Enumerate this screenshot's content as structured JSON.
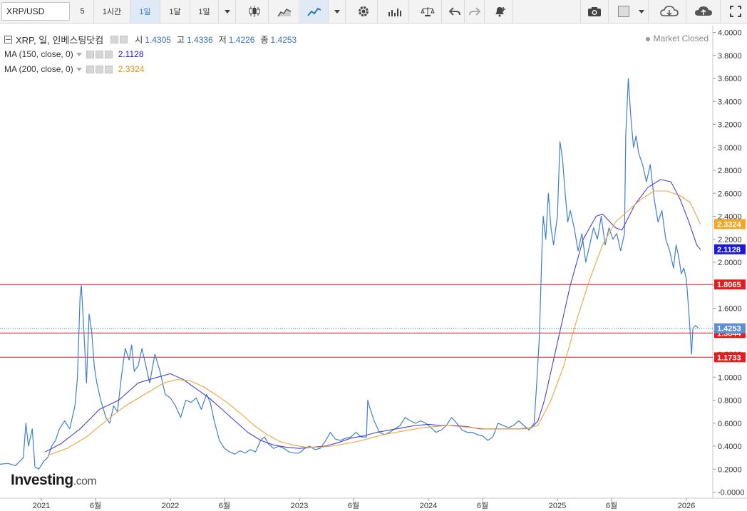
{
  "toolbar": {
    "symbol": "XRP/USD",
    "intervals": [
      "5",
      "1시간",
      "1일",
      "1달",
      "1일"
    ],
    "active_interval_index": 2
  },
  "legend": {
    "main": {
      "title": "XRP, 일, 인베스팅닷컴",
      "o_label": "시",
      "o": "1.4305",
      "h_label": "고",
      "h": "1.4336",
      "l_label": "저",
      "l": "1.4226",
      "c_label": "종",
      "c": "1.4253"
    },
    "ma150": {
      "label": "MA (150, close, 0)",
      "value": "2.1128",
      "color": "#1a1ad6"
    },
    "ma200": {
      "label": "MA (200, close, 0)",
      "value": "2.3324",
      "color": "#f08c00"
    }
  },
  "market_status": "Market Closed",
  "logo": {
    "main": "Investing",
    "suffix": ".com"
  },
  "colors": {
    "price": "#3f7fd0",
    "ma150": "#4a3fd6",
    "ma200": "#f2a33a",
    "hline": "#d42020",
    "last": "#5d8fd6"
  },
  "chart_data": {
    "type": "line",
    "y_ticks": [
      "4.0000",
      "3.8000",
      "3.6000",
      "3.4000",
      "3.2000",
      "3.0000",
      "2.8000",
      "2.6000",
      "2.4000",
      "2.2000",
      "2.0000",
      "1.8000",
      "1.6000",
      "1.4000",
      "1.2000",
      "1.0000",
      "0.8000",
      "0.6000",
      "0.4000",
      "0.2000",
      "-0.0000"
    ],
    "ylim": [
      0,
      4.0
    ],
    "x_labels": [
      {
        "label": "2021",
        "t": 2021.0
      },
      {
        "label": "6월",
        "t": 2021.42
      },
      {
        "label": "2022",
        "t": 2022.0
      },
      {
        "label": "6월",
        "t": 2022.42
      },
      {
        "label": "2023",
        "t": 2023.0
      },
      {
        "label": "6월",
        "t": 2023.42
      },
      {
        "label": "2024",
        "t": 2024.0
      },
      {
        "label": "6월",
        "t": 2024.42
      },
      {
        "label": "2025",
        "t": 2025.0
      },
      {
        "label": "6월",
        "t": 2025.42
      },
      {
        "label": "2026",
        "t": 2026.0
      }
    ],
    "xlim": [
      2020.66,
      2026.17
    ],
    "horizontal_lines": [
      {
        "value": 1.8065,
        "label": "1.8065"
      },
      {
        "value": 1.3844,
        "label": "1.3844"
      },
      {
        "value": 1.1733,
        "label": "1.1733"
      }
    ],
    "last_price": {
      "value": 1.4253,
      "label": "1.4253"
    },
    "ma150_last": {
      "value": 2.1128,
      "label": "2.1128"
    },
    "ma200_last": {
      "value": 2.3324,
      "label": "2.3324"
    },
    "series": [
      {
        "name": "XRP",
        "points": [
          [
            2020.66,
            0.24
          ],
          [
            2020.74,
            0.25
          ],
          [
            2020.8,
            0.23
          ],
          [
            2020.86,
            0.3
          ],
          [
            2020.88,
            0.6
          ],
          [
            2020.9,
            0.4
          ],
          [
            2020.93,
            0.55
          ],
          [
            2020.95,
            0.22
          ],
          [
            2020.98,
            0.2
          ],
          [
            2021.02,
            0.27
          ],
          [
            2021.05,
            0.3
          ],
          [
            2021.08,
            0.4
          ],
          [
            2021.11,
            0.45
          ],
          [
            2021.14,
            0.55
          ],
          [
            2021.18,
            0.62
          ],
          [
            2021.22,
            0.55
          ],
          [
            2021.26,
            0.75
          ],
          [
            2021.28,
            1.0
          ],
          [
            2021.3,
            1.7
          ],
          [
            2021.31,
            1.8
          ],
          [
            2021.33,
            1.4
          ],
          [
            2021.35,
            0.95
          ],
          [
            2021.37,
            1.55
          ],
          [
            2021.39,
            1.4
          ],
          [
            2021.41,
            1.1
          ],
          [
            2021.43,
            0.95
          ],
          [
            2021.46,
            0.8
          ],
          [
            2021.5,
            0.65
          ],
          [
            2021.53,
            0.6
          ],
          [
            2021.56,
            0.75
          ],
          [
            2021.59,
            0.7
          ],
          [
            2021.62,
            1.0
          ],
          [
            2021.65,
            1.25
          ],
          [
            2021.68,
            1.15
          ],
          [
            2021.7,
            1.28
          ],
          [
            2021.72,
            1.05
          ],
          [
            2021.75,
            1.1
          ],
          [
            2021.78,
            1.25
          ],
          [
            2021.81,
            1.1
          ],
          [
            2021.84,
            0.95
          ],
          [
            2021.88,
            1.2
          ],
          [
            2021.92,
            1.05
          ],
          [
            2021.96,
            0.85
          ],
          [
            2022.0,
            0.82
          ],
          [
            2022.04,
            0.75
          ],
          [
            2022.08,
            0.65
          ],
          [
            2022.12,
            0.8
          ],
          [
            2022.16,
            0.78
          ],
          [
            2022.2,
            0.82
          ],
          [
            2022.24,
            0.72
          ],
          [
            2022.28,
            0.85
          ],
          [
            2022.31,
            0.78
          ],
          [
            2022.34,
            0.62
          ],
          [
            2022.38,
            0.45
          ],
          [
            2022.42,
            0.38
          ],
          [
            2022.46,
            0.35
          ],
          [
            2022.5,
            0.33
          ],
          [
            2022.54,
            0.36
          ],
          [
            2022.58,
            0.34
          ],
          [
            2022.62,
            0.37
          ],
          [
            2022.66,
            0.35
          ],
          [
            2022.7,
            0.45
          ],
          [
            2022.73,
            0.48
          ],
          [
            2022.76,
            0.42
          ],
          [
            2022.8,
            0.38
          ],
          [
            2022.84,
            0.4
          ],
          [
            2022.88,
            0.38
          ],
          [
            2022.92,
            0.35
          ],
          [
            2022.96,
            0.34
          ],
          [
            2023.0,
            0.34
          ],
          [
            2023.04,
            0.38
          ],
          [
            2023.08,
            0.4
          ],
          [
            2023.12,
            0.37
          ],
          [
            2023.16,
            0.38
          ],
          [
            2023.2,
            0.44
          ],
          [
            2023.24,
            0.52
          ],
          [
            2023.28,
            0.46
          ],
          [
            2023.32,
            0.45
          ],
          [
            2023.36,
            0.47
          ],
          [
            2023.4,
            0.48
          ],
          [
            2023.44,
            0.52
          ],
          [
            2023.48,
            0.48
          ],
          [
            2023.52,
            0.48
          ],
          [
            2023.53,
            0.8
          ],
          [
            2023.55,
            0.72
          ],
          [
            2023.58,
            0.62
          ],
          [
            2023.62,
            0.52
          ],
          [
            2023.66,
            0.5
          ],
          [
            2023.7,
            0.52
          ],
          [
            2023.74,
            0.55
          ],
          [
            2023.78,
            0.58
          ],
          [
            2023.82,
            0.65
          ],
          [
            2023.86,
            0.62
          ],
          [
            2023.9,
            0.6
          ],
          [
            2023.94,
            0.62
          ],
          [
            2023.98,
            0.6
          ],
          [
            2024.02,
            0.56
          ],
          [
            2024.06,
            0.52
          ],
          [
            2024.1,
            0.54
          ],
          [
            2024.14,
            0.58
          ],
          [
            2024.18,
            0.65
          ],
          [
            2024.22,
            0.6
          ],
          [
            2024.26,
            0.54
          ],
          [
            2024.3,
            0.52
          ],
          [
            2024.34,
            0.52
          ],
          [
            2024.38,
            0.5
          ],
          [
            2024.42,
            0.49
          ],
          [
            2024.46,
            0.45
          ],
          [
            2024.5,
            0.48
          ],
          [
            2024.54,
            0.6
          ],
          [
            2024.58,
            0.58
          ],
          [
            2024.62,
            0.56
          ],
          [
            2024.66,
            0.58
          ],
          [
            2024.7,
            0.62
          ],
          [
            2024.74,
            0.58
          ],
          [
            2024.78,
            0.54
          ],
          [
            2024.82,
            0.6
          ],
          [
            2024.84,
            0.95
          ],
          [
            2024.86,
            1.35
          ],
          [
            2024.88,
            2.1
          ],
          [
            2024.89,
            2.4
          ],
          [
            2024.91,
            2.2
          ],
          [
            2024.93,
            2.6
          ],
          [
            2024.95,
            2.3
          ],
          [
            2024.97,
            2.15
          ],
          [
            2025.0,
            2.4
          ],
          [
            2025.02,
            3.05
          ],
          [
            2025.04,
            2.9
          ],
          [
            2025.06,
            2.6
          ],
          [
            2025.08,
            2.35
          ],
          [
            2025.1,
            2.45
          ],
          [
            2025.13,
            2.3
          ],
          [
            2025.16,
            2.1
          ],
          [
            2025.19,
            2.25
          ],
          [
            2025.22,
            2.0
          ],
          [
            2025.25,
            2.15
          ],
          [
            2025.28,
            2.3
          ],
          [
            2025.31,
            2.2
          ],
          [
            2025.34,
            2.4
          ],
          [
            2025.37,
            2.15
          ],
          [
            2025.4,
            2.3
          ],
          [
            2025.43,
            2.2
          ],
          [
            2025.46,
            2.25
          ],
          [
            2025.49,
            2.1
          ],
          [
            2025.52,
            2.25
          ],
          [
            2025.53,
            3.1
          ],
          [
            2025.55,
            3.6
          ],
          [
            2025.57,
            3.25
          ],
          [
            2025.59,
            3.0
          ],
          [
            2025.61,
            3.1
          ],
          [
            2025.63,
            2.95
          ],
          [
            2025.66,
            2.85
          ],
          [
            2025.69,
            2.7
          ],
          [
            2025.72,
            2.85
          ],
          [
            2025.75,
            2.55
          ],
          [
            2025.78,
            2.35
          ],
          [
            2025.81,
            2.45
          ],
          [
            2025.84,
            2.2
          ],
          [
            2025.87,
            2.1
          ],
          [
            2025.9,
            1.95
          ],
          [
            2025.92,
            2.15
          ],
          [
            2025.94,
            2.05
          ],
          [
            2025.96,
            1.9
          ],
          [
            2025.98,
            1.95
          ],
          [
            2026.0,
            1.85
          ],
          [
            2026.02,
            1.55
          ],
          [
            2026.04,
            1.2
          ],
          [
            2026.05,
            1.42
          ],
          [
            2026.07,
            1.45
          ],
          [
            2026.09,
            1.43
          ]
        ]
      },
      {
        "name": "MA (150, close, 0)",
        "points": [
          [
            2021.03,
            0.35
          ],
          [
            2021.15,
            0.42
          ],
          [
            2021.3,
            0.55
          ],
          [
            2021.45,
            0.72
          ],
          [
            2021.6,
            0.8
          ],
          [
            2021.75,
            0.95
          ],
          [
            2021.9,
            1.0
          ],
          [
            2022.0,
            1.03
          ],
          [
            2022.1,
            0.98
          ],
          [
            2022.2,
            0.9
          ],
          [
            2022.3,
            0.82
          ],
          [
            2022.4,
            0.72
          ],
          [
            2022.5,
            0.62
          ],
          [
            2022.6,
            0.52
          ],
          [
            2022.7,
            0.45
          ],
          [
            2022.8,
            0.41
          ],
          [
            2022.9,
            0.39
          ],
          [
            2023.0,
            0.38
          ],
          [
            2023.1,
            0.39
          ],
          [
            2023.2,
            0.4
          ],
          [
            2023.3,
            0.43
          ],
          [
            2023.4,
            0.47
          ],
          [
            2023.5,
            0.49
          ],
          [
            2023.6,
            0.52
          ],
          [
            2023.7,
            0.54
          ],
          [
            2023.8,
            0.56
          ],
          [
            2023.9,
            0.58
          ],
          [
            2024.0,
            0.59
          ],
          [
            2024.1,
            0.58
          ],
          [
            2024.2,
            0.58
          ],
          [
            2024.3,
            0.57
          ],
          [
            2024.4,
            0.55
          ],
          [
            2024.5,
            0.55
          ],
          [
            2024.6,
            0.55
          ],
          [
            2024.7,
            0.55
          ],
          [
            2024.8,
            0.56
          ],
          [
            2024.85,
            0.62
          ],
          [
            2024.9,
            0.8
          ],
          [
            2025.0,
            1.3
          ],
          [
            2025.1,
            1.8
          ],
          [
            2025.2,
            2.2
          ],
          [
            2025.3,
            2.4
          ],
          [
            2025.35,
            2.42
          ],
          [
            2025.45,
            2.3
          ],
          [
            2025.5,
            2.28
          ],
          [
            2025.6,
            2.5
          ],
          [
            2025.7,
            2.65
          ],
          [
            2025.8,
            2.72
          ],
          [
            2025.88,
            2.7
          ],
          [
            2025.95,
            2.55
          ],
          [
            2026.02,
            2.35
          ],
          [
            2026.08,
            2.15
          ],
          [
            2026.11,
            2.11
          ]
        ]
      },
      {
        "name": "MA (200, close, 0)",
        "points": [
          [
            2021.05,
            0.32
          ],
          [
            2021.2,
            0.38
          ],
          [
            2021.35,
            0.48
          ],
          [
            2021.5,
            0.62
          ],
          [
            2021.65,
            0.75
          ],
          [
            2021.8,
            0.85
          ],
          [
            2021.95,
            0.95
          ],
          [
            2022.05,
            0.98
          ],
          [
            2022.15,
            0.97
          ],
          [
            2022.25,
            0.92
          ],
          [
            2022.35,
            0.85
          ],
          [
            2022.45,
            0.77
          ],
          [
            2022.55,
            0.68
          ],
          [
            2022.65,
            0.58
          ],
          [
            2022.75,
            0.5
          ],
          [
            2022.85,
            0.44
          ],
          [
            2022.95,
            0.41
          ],
          [
            2023.05,
            0.39
          ],
          [
            2023.15,
            0.39
          ],
          [
            2023.25,
            0.4
          ],
          [
            2023.35,
            0.42
          ],
          [
            2023.45,
            0.44
          ],
          [
            2023.55,
            0.47
          ],
          [
            2023.65,
            0.5
          ],
          [
            2023.75,
            0.52
          ],
          [
            2023.85,
            0.54
          ],
          [
            2023.95,
            0.56
          ],
          [
            2024.05,
            0.57
          ],
          [
            2024.15,
            0.58
          ],
          [
            2024.25,
            0.57
          ],
          [
            2024.35,
            0.56
          ],
          [
            2024.45,
            0.55
          ],
          [
            2024.55,
            0.55
          ],
          [
            2024.65,
            0.55
          ],
          [
            2024.75,
            0.55
          ],
          [
            2024.85,
            0.58
          ],
          [
            2024.95,
            0.8
          ],
          [
            2025.05,
            1.1
          ],
          [
            2025.15,
            1.5
          ],
          [
            2025.25,
            1.85
          ],
          [
            2025.35,
            2.15
          ],
          [
            2025.45,
            2.35
          ],
          [
            2025.55,
            2.45
          ],
          [
            2025.65,
            2.55
          ],
          [
            2025.75,
            2.62
          ],
          [
            2025.85,
            2.62
          ],
          [
            2025.95,
            2.58
          ],
          [
            2026.03,
            2.52
          ],
          [
            2026.08,
            2.4
          ],
          [
            2026.11,
            2.33
          ]
        ]
      }
    ]
  }
}
